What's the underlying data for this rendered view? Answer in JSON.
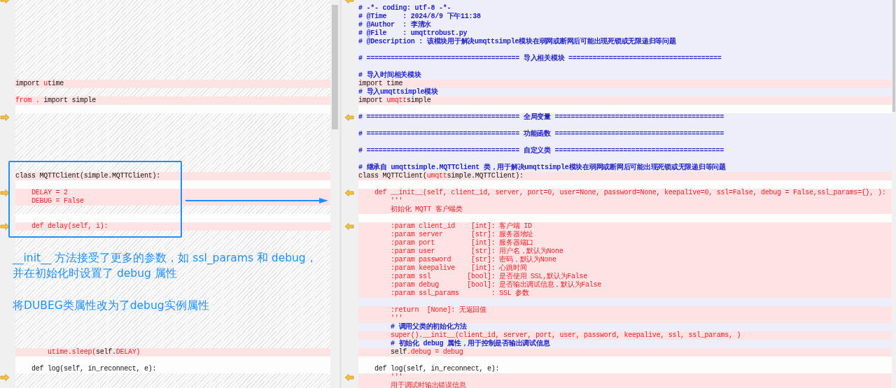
{
  "left_pane": {
    "lines": [
      {
        "kind": "gap",
        "marker": true
      },
      {
        "kind": "gap",
        "marker": false
      },
      {
        "kind": "gap",
        "marker": false
      },
      {
        "kind": "gap",
        "marker": false
      },
      {
        "kind": "gap",
        "marker": false
      },
      {
        "kind": "gap",
        "marker": false
      },
      {
        "kind": "gap",
        "marker": false
      },
      {
        "kind": "gap",
        "marker": false
      },
      {
        "kind": "gap",
        "marker": false
      },
      {
        "kind": "gap",
        "marker": false
      },
      {
        "kind": "changed",
        "marker": false,
        "parts": [
          {
            "text": "import ",
            "diff": false
          },
          {
            "text": "u",
            "diff": true
          },
          {
            "text": "time",
            "diff": false
          }
        ]
      },
      {
        "kind": "gap",
        "marker": false
      },
      {
        "kind": "changed",
        "marker": false,
        "parts": [
          {
            "text": "from .",
            "diff": true
          },
          {
            "text": " import simple",
            "diff": false
          }
        ]
      },
      {
        "kind": "same",
        "marker": false
      },
      {
        "kind": "gap",
        "marker": true
      },
      {
        "kind": "gap",
        "marker": false
      },
      {
        "kind": "gap",
        "marker": false
      },
      {
        "kind": "gap",
        "marker": false
      },
      {
        "kind": "gap",
        "marker": false
      },
      {
        "kind": "gap",
        "marker": false
      },
      {
        "kind": "gap",
        "marker": false
      },
      {
        "kind": "changed",
        "marker": false,
        "parts": [
          {
            "text": "class MQTTClient(simple.MQTTClient):",
            "diff": false
          }
        ]
      },
      {
        "kind": "same",
        "marker": false
      },
      {
        "kind": "changed",
        "marker": true,
        "parts": [
          {
            "text": "    DELAY = 2",
            "diff": true
          }
        ]
      },
      {
        "kind": "changed",
        "marker": false,
        "parts": [
          {
            "text": "    DEBUG = False",
            "diff": true
          }
        ]
      },
      {
        "kind": "gap",
        "marker": false
      },
      {
        "kind": "same",
        "marker": false
      },
      {
        "kind": "changed",
        "marker": true,
        "parts": [
          {
            "text": "    def delay(self, i):",
            "diff": true
          }
        ]
      },
      {
        "kind": "gap",
        "marker": false
      },
      {
        "kind": "gap",
        "marker": false
      },
      {
        "kind": "gap",
        "marker": false
      },
      {
        "kind": "gap",
        "marker": false
      },
      {
        "kind": "gap",
        "marker": false
      },
      {
        "kind": "gap",
        "marker": false
      },
      {
        "kind": "gap",
        "marker": false
      },
      {
        "kind": "gap",
        "marker": false
      },
      {
        "kind": "gap",
        "marker": false
      },
      {
        "kind": "gap",
        "marker": false
      },
      {
        "kind": "gap",
        "marker": false
      },
      {
        "kind": "gap",
        "marker": false
      },
      {
        "kind": "gap",
        "marker": false
      },
      {
        "kind": "gap",
        "marker": false
      },
      {
        "kind": "changed",
        "marker": false,
        "parts": [
          {
            "text": "        utime.sleep(",
            "diff": true
          },
          {
            "text": "self.",
            "diff": false
          },
          {
            "text": "DELAY)",
            "diff": true
          }
        ]
      },
      {
        "kind": "same",
        "marker": false
      },
      {
        "kind": "same",
        "marker": false,
        "parts": [
          {
            "text": "    def log(self, in_reconnect, e):",
            "diff": false
          }
        ]
      },
      {
        "kind": "gap",
        "marker": true
      },
      {
        "kind": "gap",
        "marker": false
      }
    ]
  },
  "right_pane": {
    "lines": [
      {
        "kind": "comment",
        "marker": true
      },
      {
        "kind": "comment",
        "marker": false,
        "text": "# -*- coding: utf-8 -*-"
      },
      {
        "kind": "comment",
        "marker": false,
        "text": "# @Time    : 2024/8/9 下午11:38"
      },
      {
        "kind": "comment",
        "marker": false,
        "text": "# @Author  : 李清水"
      },
      {
        "kind": "comment",
        "marker": false,
        "text": "# @File    : umqttrobust.py"
      },
      {
        "kind": "comment",
        "marker": false,
        "text": "# @Description : 该模块用于解决umqttsimple模块在弱网或断网后可能出现死锁或无限递归等问题"
      },
      {
        "kind": "comment",
        "marker": false
      },
      {
        "kind": "comment",
        "marker": false,
        "text": "# ====================================== 导入相关模块 ======================================"
      },
      {
        "kind": "comment",
        "marker": false
      },
      {
        "kind": "comment",
        "marker": false,
        "text": "# 导入时间相关模块"
      },
      {
        "kind": "changed",
        "marker": false,
        "parts": [
          {
            "text": "import time",
            "diff": false
          }
        ]
      },
      {
        "kind": "comment",
        "marker": false,
        "text": "# 导入umqttsimple模块"
      },
      {
        "kind": "changed",
        "marker": false,
        "parts": [
          {
            "text": "import ",
            "diff": false
          },
          {
            "text": "umqtt",
            "diff": true
          },
          {
            "text": "simple",
            "diff": false
          }
        ]
      },
      {
        "kind": "same",
        "marker": false
      },
      {
        "kind": "comment",
        "marker": true,
        "text": "# ====================================== 全局变量 =========================================="
      },
      {
        "kind": "comment",
        "marker": false
      },
      {
        "kind": "comment",
        "marker": false,
        "text": "# ====================================== 功能函数 =========================================="
      },
      {
        "kind": "comment",
        "marker": false
      },
      {
        "kind": "comment",
        "marker": false,
        "text": "# ====================================== 自定义类 =========================================="
      },
      {
        "kind": "comment",
        "marker": false
      },
      {
        "kind": "comment",
        "marker": false,
        "text": "# 继承自 umqttsimple.MQTTClient 类，用于解决umqttsimple模块在弱网或断网后可能出现死锁或无限递归等问题"
      },
      {
        "kind": "changed",
        "marker": false,
        "parts": [
          {
            "text": "class MQTTClient(",
            "diff": false
          },
          {
            "text": "umqtt",
            "diff": true
          },
          {
            "text": "simple.MQTTClient):",
            "diff": false
          }
        ]
      },
      {
        "kind": "same",
        "marker": false
      },
      {
        "kind": "changed",
        "marker": true,
        "parts": [
          {
            "text": "    def __init__(self, client_id, server, port=0, user=None, password=None, keepalive=0, ssl=False, debug = False,ssl_params={}, ):",
            "diff": true
          }
        ]
      },
      {
        "kind": "changed",
        "marker": false,
        "parts": [
          {
            "text": "        '''",
            "diff": true
          }
        ]
      },
      {
        "kind": "changed",
        "marker": false,
        "parts": [
          {
            "text": "        初始化 MQTT 客户端类",
            "diff": true
          }
        ]
      },
      {
        "kind": "same",
        "marker": false
      },
      {
        "kind": "changed",
        "marker": true,
        "parts": [
          {
            "text": "        :param client_id    [int]: 客户端 ID",
            "diff": true
          }
        ]
      },
      {
        "kind": "changed",
        "marker": false,
        "parts": [
          {
            "text": "        :param server       [str]: 服务器地址",
            "diff": true
          }
        ]
      },
      {
        "kind": "changed",
        "marker": false,
        "parts": [
          {
            "text": "        :param port         [int]: 服务器端口",
            "diff": true
          }
        ]
      },
      {
        "kind": "changed",
        "marker": false,
        "parts": [
          {
            "text": "        :param user         [str]: 用户名，默认为None",
            "diff": true
          }
        ]
      },
      {
        "kind": "changed",
        "marker": false,
        "parts": [
          {
            "text": "        :param password     [str]: 密码，默认为None",
            "diff": true
          }
        ]
      },
      {
        "kind": "changed",
        "marker": false,
        "parts": [
          {
            "text": "        :param keepalive    [int]: 心跳时间",
            "diff": true
          }
        ]
      },
      {
        "kind": "changed",
        "marker": false,
        "parts": [
          {
            "text": "        :param ssl         [bool]: 是否使用 SSL,默认为False",
            "diff": true
          }
        ]
      },
      {
        "kind": "changed",
        "marker": false,
        "parts": [
          {
            "text": "        :param debug       [bool]: 是否输出调试信息，默认为False",
            "diff": true
          }
        ]
      },
      {
        "kind": "changed",
        "marker": false,
        "parts": [
          {
            "text": "        :param ssl_params        : SSL 参数",
            "diff": true
          }
        ]
      },
      {
        "kind": "comment",
        "marker": false
      },
      {
        "kind": "changed",
        "marker": false,
        "parts": [
          {
            "text": "        :return  [None]: 无返回值",
            "diff": true
          }
        ]
      },
      {
        "kind": "changed",
        "marker": false,
        "parts": [
          {
            "text": "        '''",
            "diff": true
          }
        ]
      },
      {
        "kind": "comment",
        "marker": false,
        "text": "        # 调用父类的初始化方法"
      },
      {
        "kind": "changed",
        "marker": false,
        "parts": [
          {
            "text": "        super().__init__(client_id, server, port, user, password, keepalive, ssl, ssl_params, )",
            "diff": true
          }
        ]
      },
      {
        "kind": "comment",
        "marker": false,
        "text": "        # 初始化 debug 属性，用于控制是否输出调试信息"
      },
      {
        "kind": "changed",
        "marker": false,
        "parts": [
          {
            "text": "        self",
            "diff": false
          },
          {
            "text": ".debug = debug",
            "diff": true
          }
        ]
      },
      {
        "kind": "same",
        "marker": false
      },
      {
        "kind": "same",
        "marker": false,
        "parts": [
          {
            "text": "    def log(self, in_reconnect, e):",
            "diff": false
          }
        ]
      },
      {
        "kind": "changed",
        "marker": true,
        "parts": [
          {
            "text": "        '''",
            "diff": true
          }
        ]
      },
      {
        "kind": "changed",
        "marker": false,
        "parts": [
          {
            "text": "        用于调试时输出错误信息",
            "diff": true
          }
        ]
      }
    ]
  },
  "annotation": {
    "explanation": [
      "__init__ 方法接受了更多的参数，如 ssl_params 和 debug，",
      "并在初始化时设置了 debug 属性"
    ],
    "note": "将DUBEG类属性改为了debug实例属性"
  }
}
